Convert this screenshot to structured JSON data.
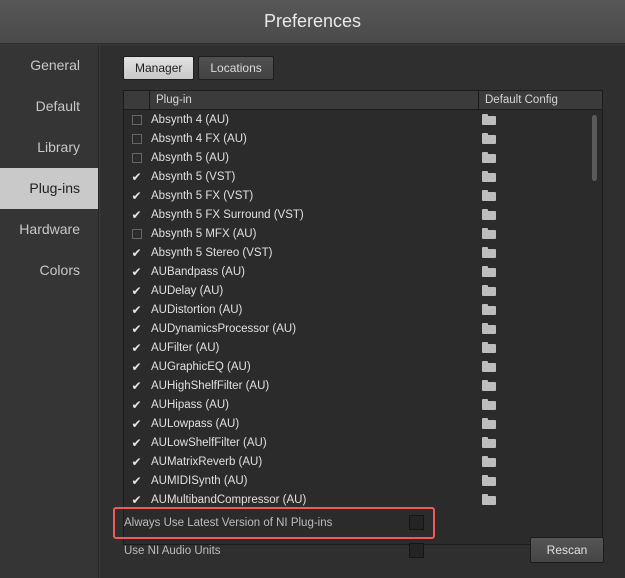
{
  "window": {
    "title": "Preferences"
  },
  "sidebar": {
    "items": [
      {
        "label": "General",
        "active": false
      },
      {
        "label": "Default",
        "active": false
      },
      {
        "label": "Library",
        "active": false
      },
      {
        "label": "Plug-ins",
        "active": true
      },
      {
        "label": "Hardware",
        "active": false
      },
      {
        "label": "Colors",
        "active": false
      }
    ]
  },
  "tabs": [
    {
      "label": "Manager",
      "active": true
    },
    {
      "label": "Locations",
      "active": false
    }
  ],
  "table": {
    "columns": {
      "plugin": "Plug-in",
      "config": "Default Config"
    },
    "rows": [
      {
        "name": "Absynth 4 (AU)",
        "checked": false
      },
      {
        "name": "Absynth 4 FX (AU)",
        "checked": false
      },
      {
        "name": "Absynth 5 (AU)",
        "checked": false
      },
      {
        "name": "Absynth 5 (VST)",
        "checked": true
      },
      {
        "name": "Absynth 5 FX (VST)",
        "checked": true
      },
      {
        "name": "Absynth 5 FX Surround (VST)",
        "checked": true
      },
      {
        "name": "Absynth 5 MFX (AU)",
        "checked": false
      },
      {
        "name": "Absynth 5 Stereo (VST)",
        "checked": true
      },
      {
        "name": "AUBandpass (AU)",
        "checked": true
      },
      {
        "name": "AUDelay (AU)",
        "checked": true
      },
      {
        "name": "AUDistortion (AU)",
        "checked": true
      },
      {
        "name": "AUDynamicsProcessor (AU)",
        "checked": true
      },
      {
        "name": "AUFilter (AU)",
        "checked": true
      },
      {
        "name": "AUGraphicEQ (AU)",
        "checked": true
      },
      {
        "name": "AUHighShelfFilter (AU)",
        "checked": true
      },
      {
        "name": "AUHipass (AU)",
        "checked": true
      },
      {
        "name": "AULowpass (AU)",
        "checked": true
      },
      {
        "name": "AULowShelfFilter (AU)",
        "checked": true
      },
      {
        "name": "AUMatrixReverb (AU)",
        "checked": true
      },
      {
        "name": "AUMIDISynth (AU)",
        "checked": true
      },
      {
        "name": "AUMultibandCompressor (AU)",
        "checked": true
      }
    ]
  },
  "options": {
    "always_latest": {
      "label": "Always Use Latest Version of NI Plug-ins",
      "checked": false
    },
    "ni_audio_units": {
      "label": "Use NI Audio Units",
      "checked": false
    }
  },
  "buttons": {
    "rescan": "Rescan"
  },
  "colors": {
    "highlight": "#ef5a5a",
    "active_item": "#c9c9c9"
  }
}
